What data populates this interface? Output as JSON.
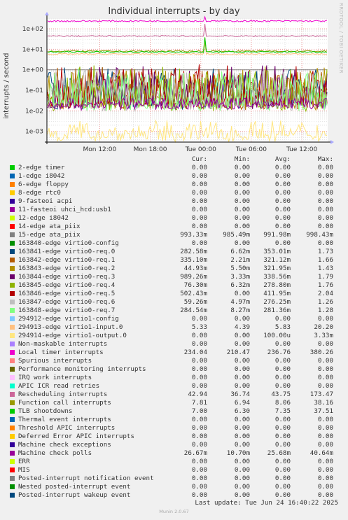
{
  "title": "Individual interrupts - by day",
  "side_note": "RRDTOOL / TOBI OETIKER",
  "footer": {
    "last_update": "Last update: Tue Jun 24 16:40:22 2025",
    "generator": "Munin 2.0.67"
  },
  "columns": {
    "cur": "Cur:",
    "min": "Min:",
    "avg": "Avg:",
    "max": "Max:"
  },
  "chart_data": {
    "type": "line",
    "title": "Individual interrupts - by day",
    "ylabel": "interrupts / second",
    "xlabel": "",
    "y_scale": "log",
    "ylim": [
      0.0003,
      300
    ],
    "y_ticks": [
      "1e-03",
      "1e-02",
      "1e-01",
      "1e+00",
      "1e+01",
      "1e+02"
    ],
    "x_ticks": [
      "Mon 12:00",
      "Mon 18:00",
      "Tue 00:00",
      "Tue 06:00",
      "Tue 12:00"
    ],
    "grid": true,
    "series": [
      {
        "name": "2-edge timer",
        "color": "#00cc00",
        "cur": "0.00",
        "min": "0.00",
        "avg": "0.00",
        "max": "0.00"
      },
      {
        "name": "1-edge i8042",
        "color": "#0066b3",
        "cur": "0.00",
        "min": "0.00",
        "avg": "0.00",
        "max": "0.00"
      },
      {
        "name": "6-edge floppy",
        "color": "#ff8000",
        "cur": "0.00",
        "min": "0.00",
        "avg": "0.00",
        "max": "0.00"
      },
      {
        "name": "8-edge rtc0",
        "color": "#ffcc00",
        "cur": "0.00",
        "min": "0.00",
        "avg": "0.00",
        "max": "0.00"
      },
      {
        "name": "9-fasteoi acpi",
        "color": "#330099",
        "cur": "0.00",
        "min": "0.00",
        "avg": "0.00",
        "max": "0.00"
      },
      {
        "name": "11-fasteoi uhci_hcd:usb1",
        "color": "#990099",
        "cur": "0.00",
        "min": "0.00",
        "avg": "0.00",
        "max": "0.00"
      },
      {
        "name": "12-edge i8042",
        "color": "#ccff00",
        "cur": "0.00",
        "min": "0.00",
        "avg": "0.00",
        "max": "0.00"
      },
      {
        "name": "14-edge ata_piix",
        "color": "#ff0000",
        "cur": "0.00",
        "min": "0.00",
        "avg": "0.00",
        "max": "0.00"
      },
      {
        "name": "15-edge ata_piix",
        "color": "#808080",
        "cur": "993.33m",
        "min": "985.49m",
        "avg": "991.98m",
        "max": "998.43m"
      },
      {
        "name": "163840-edge virtio0-config",
        "color": "#008f00",
        "cur": "0.00",
        "min": "0.00",
        "avg": "0.00",
        "max": "0.00"
      },
      {
        "name": "163841-edge virtio0-req.0",
        "color": "#00487d",
        "cur": "282.58m",
        "min": "6.62m",
        "avg": "353.01m",
        "max": "1.73"
      },
      {
        "name": "163842-edge virtio0-req.1",
        "color": "#b35a00",
        "cur": "335.10m",
        "min": "2.21m",
        "avg": "321.12m",
        "max": "1.66"
      },
      {
        "name": "163843-edge virtio0-req.2",
        "color": "#b38f00",
        "cur": "44.93m",
        "min": "5.50m",
        "avg": "321.95m",
        "max": "1.43"
      },
      {
        "name": "163844-edge virtio0-req.3",
        "color": "#6b006b",
        "cur": "989.26m",
        "min": "3.33m",
        "avg": "338.56m",
        "max": "1.79"
      },
      {
        "name": "163845-edge virtio0-req.4",
        "color": "#8fb300",
        "cur": "76.30m",
        "min": "6.32m",
        "avg": "278.80m",
        "max": "1.76"
      },
      {
        "name": "163846-edge virtio0-req.5",
        "color": "#b30000",
        "cur": "502.43m",
        "min": "0.00",
        "avg": "411.95m",
        "max": "2.04"
      },
      {
        "name": "163847-edge virtio0-req.6",
        "color": "#bebebe",
        "cur": "59.26m",
        "min": "4.97m",
        "avg": "276.25m",
        "max": "1.26"
      },
      {
        "name": "163848-edge virtio0-req.7",
        "color": "#80ff80",
        "cur": "284.54m",
        "min": "8.27m",
        "avg": "281.36m",
        "max": "1.28"
      },
      {
        "name": "294912-edge virtio1-config",
        "color": "#80c9ff",
        "cur": "0.00",
        "min": "0.00",
        "avg": "0.00",
        "max": "0.00"
      },
      {
        "name": "294913-edge virtio1-input.0",
        "color": "#ffc080",
        "cur": "5.33",
        "min": "4.39",
        "avg": "5.83",
        "max": "20.20"
      },
      {
        "name": "294914-edge virtio1-output.0",
        "color": "#ffe680",
        "cur": "0.00",
        "min": "0.00",
        "avg": "100.00u",
        "max": "3.33m"
      },
      {
        "name": "Non-maskable interrupts",
        "color": "#aa80ff",
        "cur": "0.00",
        "min": "0.00",
        "avg": "0.00",
        "max": "0.00"
      },
      {
        "name": "Local timer interrupts",
        "color": "#ee00cc",
        "cur": "234.04",
        "min": "210.47",
        "avg": "236.76",
        "max": "380.26"
      },
      {
        "name": "Spurious interrupts",
        "color": "#ff8080",
        "cur": "0.00",
        "min": "0.00",
        "avg": "0.00",
        "max": "0.00"
      },
      {
        "name": "Performance monitoring interrupts",
        "color": "#666600",
        "cur": "0.00",
        "min": "0.00",
        "avg": "0.00",
        "max": "0.00"
      },
      {
        "name": "IRQ work interrupts",
        "color": "#ffbfff",
        "cur": "0.00",
        "min": "0.00",
        "avg": "0.00",
        "max": "0.00"
      },
      {
        "name": "APIC ICR read retries",
        "color": "#00ffcc",
        "cur": "0.00",
        "min": "0.00",
        "avg": "0.00",
        "max": "0.00"
      },
      {
        "name": "Rescheduling interrupts",
        "color": "#cc6699",
        "cur": "42.94",
        "min": "36.74",
        "avg": "43.75",
        "max": "173.47"
      },
      {
        "name": "Function call interrupts",
        "color": "#999900",
        "cur": "7.81",
        "min": "6.94",
        "avg": "8.06",
        "max": "38.16"
      },
      {
        "name": "TLB shootdowns",
        "color": "#00cc00",
        "cur": "7.00",
        "min": "6.30",
        "avg": "7.35",
        "max": "37.51"
      },
      {
        "name": "Thermal event interrupts",
        "color": "#0066b3",
        "cur": "0.00",
        "min": "0.00",
        "avg": "0.00",
        "max": "0.00"
      },
      {
        "name": "Threshold APIC interrupts",
        "color": "#ff8000",
        "cur": "0.00",
        "min": "0.00",
        "avg": "0.00",
        "max": "0.00"
      },
      {
        "name": "Deferred Error APIC interrupts",
        "color": "#ffcc00",
        "cur": "0.00",
        "min": "0.00",
        "avg": "0.00",
        "max": "0.00"
      },
      {
        "name": "Machine check exceptions",
        "color": "#330099",
        "cur": "0.00",
        "min": "0.00",
        "avg": "0.00",
        "max": "0.00"
      },
      {
        "name": "Machine check polls",
        "color": "#990099",
        "cur": "26.67m",
        "min": "10.70m",
        "avg": "25.68m",
        "max": "40.64m"
      },
      {
        "name": "ERR",
        "color": "#ccff00",
        "cur": "0.00",
        "min": "0.00",
        "avg": "0.00",
        "max": "0.00"
      },
      {
        "name": "MIS",
        "color": "#ff0000",
        "cur": "0.00",
        "min": "0.00",
        "avg": "0.00",
        "max": "0.00"
      },
      {
        "name": "Posted-interrupt notification event",
        "color": "#808080",
        "cur": "0.00",
        "min": "0.00",
        "avg": "0.00",
        "max": "0.00"
      },
      {
        "name": "Nested posted-interrupt event",
        "color": "#008f00",
        "cur": "0.00",
        "min": "0.00",
        "avg": "0.00",
        "max": "0.00"
      },
      {
        "name": "Posted-interrupt wakeup event",
        "color": "#00487d",
        "cur": "0.00",
        "min": "0.00",
        "avg": "0.00",
        "max": "0.00"
      }
    ]
  }
}
